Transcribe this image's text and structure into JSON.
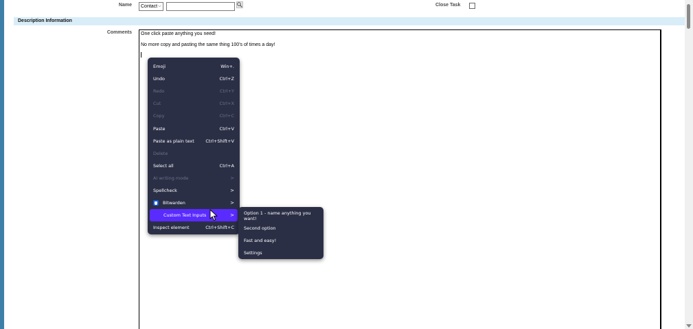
{
  "form": {
    "name_label": "Name",
    "contact_select_value": "Contact",
    "name_input_value": "",
    "close_task_label": "Close Task",
    "section_title": "Description Information",
    "comments_label": "Comments",
    "comments_lines": [
      "One click paste anything you need!",
      "No more copy and pasting the same thing 100's of times a day!"
    ]
  },
  "context_menu": {
    "items": [
      {
        "label": "Emoji",
        "shortcut": "Win+.",
        "enabled": true
      },
      {
        "label": "Undo",
        "shortcut": "Ctrl+Z",
        "enabled": true
      },
      {
        "label": "Redo",
        "shortcut": "Ctrl+Y",
        "enabled": false
      },
      {
        "label": "Cut",
        "shortcut": "Ctrl+X",
        "enabled": false
      },
      {
        "label": "Copy",
        "shortcut": "Ctrl+C",
        "enabled": false
      },
      {
        "label": "Paste",
        "shortcut": "Ctrl+V",
        "enabled": true
      },
      {
        "label": "Paste as plain text",
        "shortcut": "Ctrl+Shift+V",
        "enabled": true
      },
      {
        "label": "Delete",
        "shortcut": "",
        "enabled": false
      },
      {
        "label": "Select all",
        "shortcut": "Ctrl+A",
        "enabled": true
      },
      {
        "label": "AI writing mode",
        "shortcut": ">",
        "enabled": false
      },
      {
        "label": "Spellcheck",
        "shortcut": ">",
        "enabled": true
      },
      {
        "label": "Bitwarden",
        "shortcut": ">",
        "enabled": true,
        "icon": "bitwarden-shield-icon"
      },
      {
        "label": "Custom Text Inputs",
        "shortcut": ">",
        "enabled": true,
        "highlighted": true
      },
      {
        "label": "Inspect element",
        "shortcut": "Ctrl+Shift+C",
        "enabled": true
      }
    ]
  },
  "submenu": {
    "items": [
      {
        "label": "Option 1 - name anything you want!"
      },
      {
        "label": "Second option"
      },
      {
        "label": "Fast and easy!"
      },
      {
        "label": "Settings"
      }
    ]
  },
  "colors": {
    "menu_bg": "#2b2f46",
    "highlight": "#5a2bff",
    "section_header_bg": "#d8edf8",
    "window_frame": "#3e7fa8"
  }
}
